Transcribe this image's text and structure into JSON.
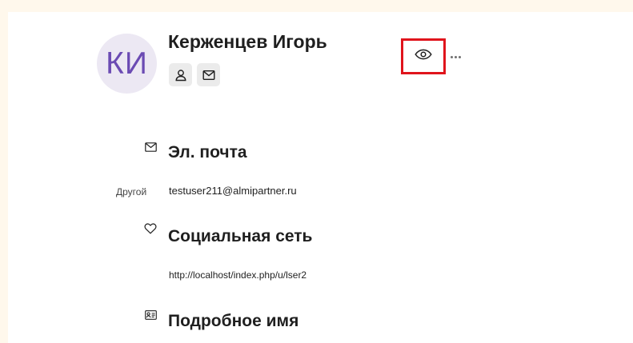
{
  "profile": {
    "avatar_initials": "КИ",
    "name": "Керженцев Игорь",
    "avatar_bg": "#ece8f3",
    "avatar_fg": "#6b4bb3"
  },
  "header_actions": {
    "profile_icon": "user-icon",
    "message_icon": "mail-icon",
    "view_icon": "eye-icon",
    "more_icon": "more-horizontal-icon",
    "highlight_color": "#e0141c"
  },
  "sections": {
    "email": {
      "title": "Эл. почта",
      "icon": "mail-icon",
      "label": "Другой",
      "value": "testuser211@almipartner.ru"
    },
    "social": {
      "title": "Социальная сеть",
      "icon": "heart-icon",
      "value": "http://localhost/index.php/u/lser2"
    },
    "fullname": {
      "title": "Подробное имя",
      "icon": "id-card-icon"
    }
  }
}
